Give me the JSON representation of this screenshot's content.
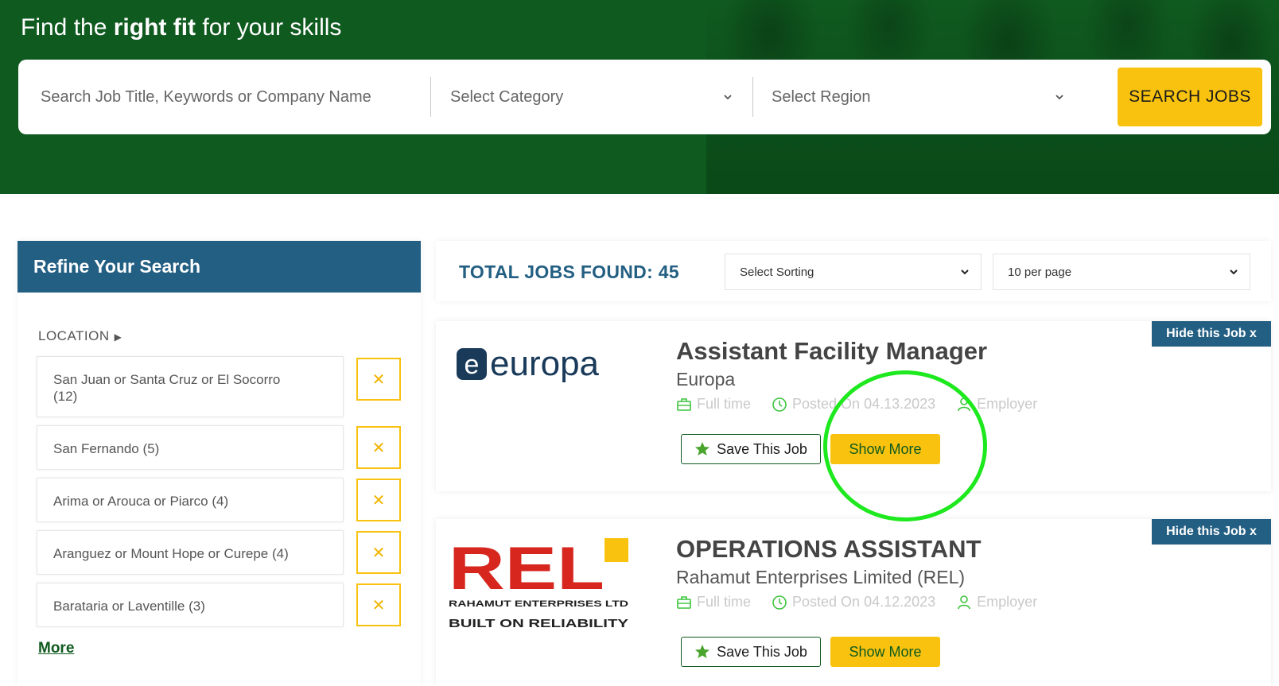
{
  "hero": {
    "title_pre": "Find the ",
    "title_bold": "right fit",
    "title_post": " for your skills"
  },
  "search": {
    "placeholder": "Search Job Title, Keywords or Company Name",
    "category_placeholder": "Select Category",
    "region_placeholder": "Select Region",
    "button_label": "SEARCH JOBS"
  },
  "sidebar": {
    "title": "Refine Your Search",
    "location_label": "LOCATION",
    "location_items": [
      {
        "label": "San Juan or Santa Cruz or El Socorro",
        "count": "(12)"
      },
      {
        "label": "San Fernando (5)"
      },
      {
        "label": "Arima or Arouca or Piarco (4)"
      },
      {
        "label": "Aranguez or Mount Hope or Curepe (4)"
      },
      {
        "label": "Barataria or Laventille (3)"
      }
    ],
    "remove_glyph": "✕",
    "more_label": "More"
  },
  "results": {
    "total_label": "TOTAL JOBS FOUND: 45",
    "sorting_label": "Select Sorting",
    "per_page_label": "10 per page"
  },
  "jobs": [
    {
      "title": "Assistant Facility Manager",
      "company": "Europa",
      "logo_text": "europa",
      "type": "Full time",
      "posted": "Posted On 04.13.2023",
      "poster": "Employer",
      "hide_label": "Hide this Job x",
      "save_label": "Save This Job",
      "show_label": "Show More"
    },
    {
      "title": "OPERATIONS ASSISTANT",
      "company": "Rahamut Enterprises Limited (REL)",
      "logo_text": "REL",
      "logo_sub1": "RAHAMUT ENTERPRISES LTD",
      "logo_sub2": "BUILT ON RELIABILITY",
      "type": "Full time",
      "posted": "Posted On 04.12.2023",
      "poster": "Employer",
      "hide_label": "Hide this Job x",
      "save_label": "Save This Job",
      "show_label": "Show More"
    }
  ],
  "colors": {
    "hero_green": "#0f5a1f",
    "accent_yellow": "#f8c20f",
    "header_blue": "#235f82",
    "meta_green": "#3cc43c",
    "highlight": "#1ee81e"
  }
}
